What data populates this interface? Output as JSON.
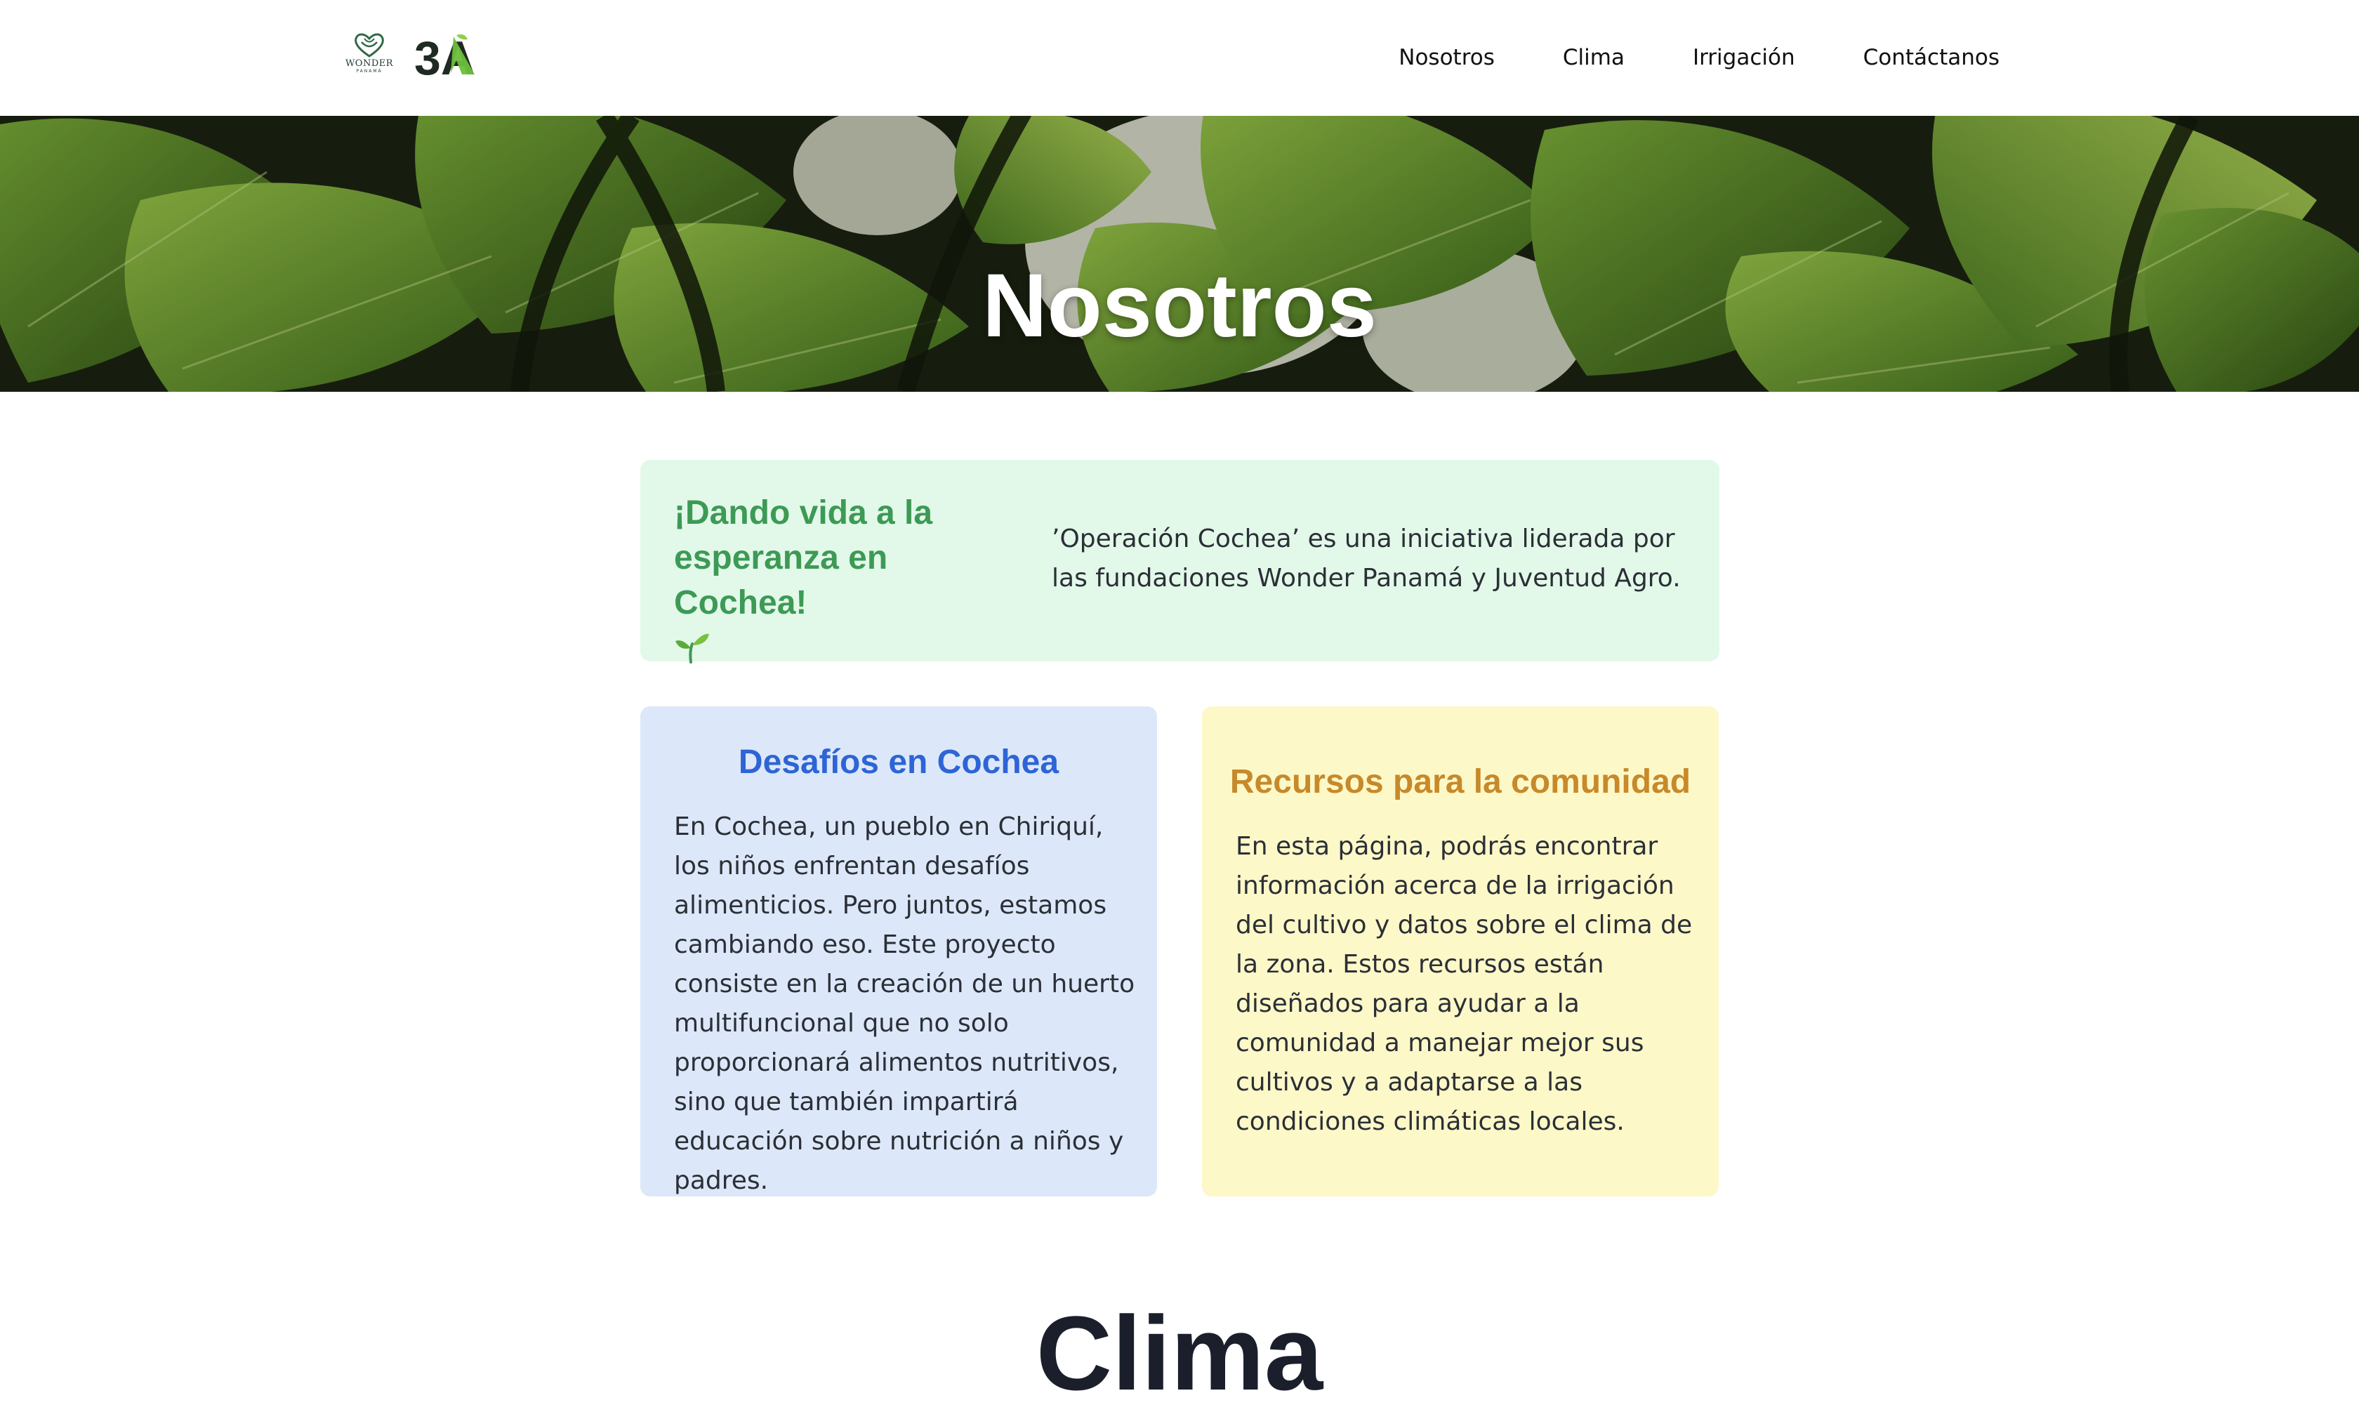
{
  "header": {
    "logos": {
      "wonder_text": "WONDER",
      "wonder_sub": "PANAMÁ",
      "juventud_agro": "3A"
    },
    "nav": [
      {
        "label": "Nosotros"
      },
      {
        "label": "Clima"
      },
      {
        "label": "Irrigación"
      },
      {
        "label": "Contáctanos"
      }
    ]
  },
  "hero": {
    "title": "Nosotros"
  },
  "intro": {
    "heading": "¡Dando vida a la esperanza en Cochea!",
    "icon": "seedling-icon",
    "text": "’Operación Cochea’ es una iniciativa liderada por las fundaciones Wonder Panamá y Juventud Agro."
  },
  "challenges": {
    "title": "Desafíos en Cochea",
    "text": "En Cochea, un pueblo en Chiriquí, los niños enfrentan desafíos alimenticios. Pero juntos, estamos cambiando eso. Este proyecto consiste en la creación de un huerto multifuncional que no solo proporcionará alimentos nutritivos, sino que también impartirá educación sobre nutrición a niños y padres."
  },
  "resources": {
    "title": "Recursos para la comunidad",
    "text": "En esta página, podrás encontrar información acerca de la irrigación del cultivo y datos sobre el clima de la zona. Estos recursos están diseñados para ayudar a la comunidad a manejar mejor sus cultivos y a adaptarse a las condiciones climáticas locales."
  },
  "next_section": {
    "title": "Clima"
  },
  "colors": {
    "intro_bg": "#e2f9ea",
    "intro_heading": "#3d9a55",
    "challenges_bg": "#dce8f9",
    "challenges_title": "#2e64d6",
    "resources_bg": "#fdf8c8",
    "resources_title": "#c7892a"
  }
}
